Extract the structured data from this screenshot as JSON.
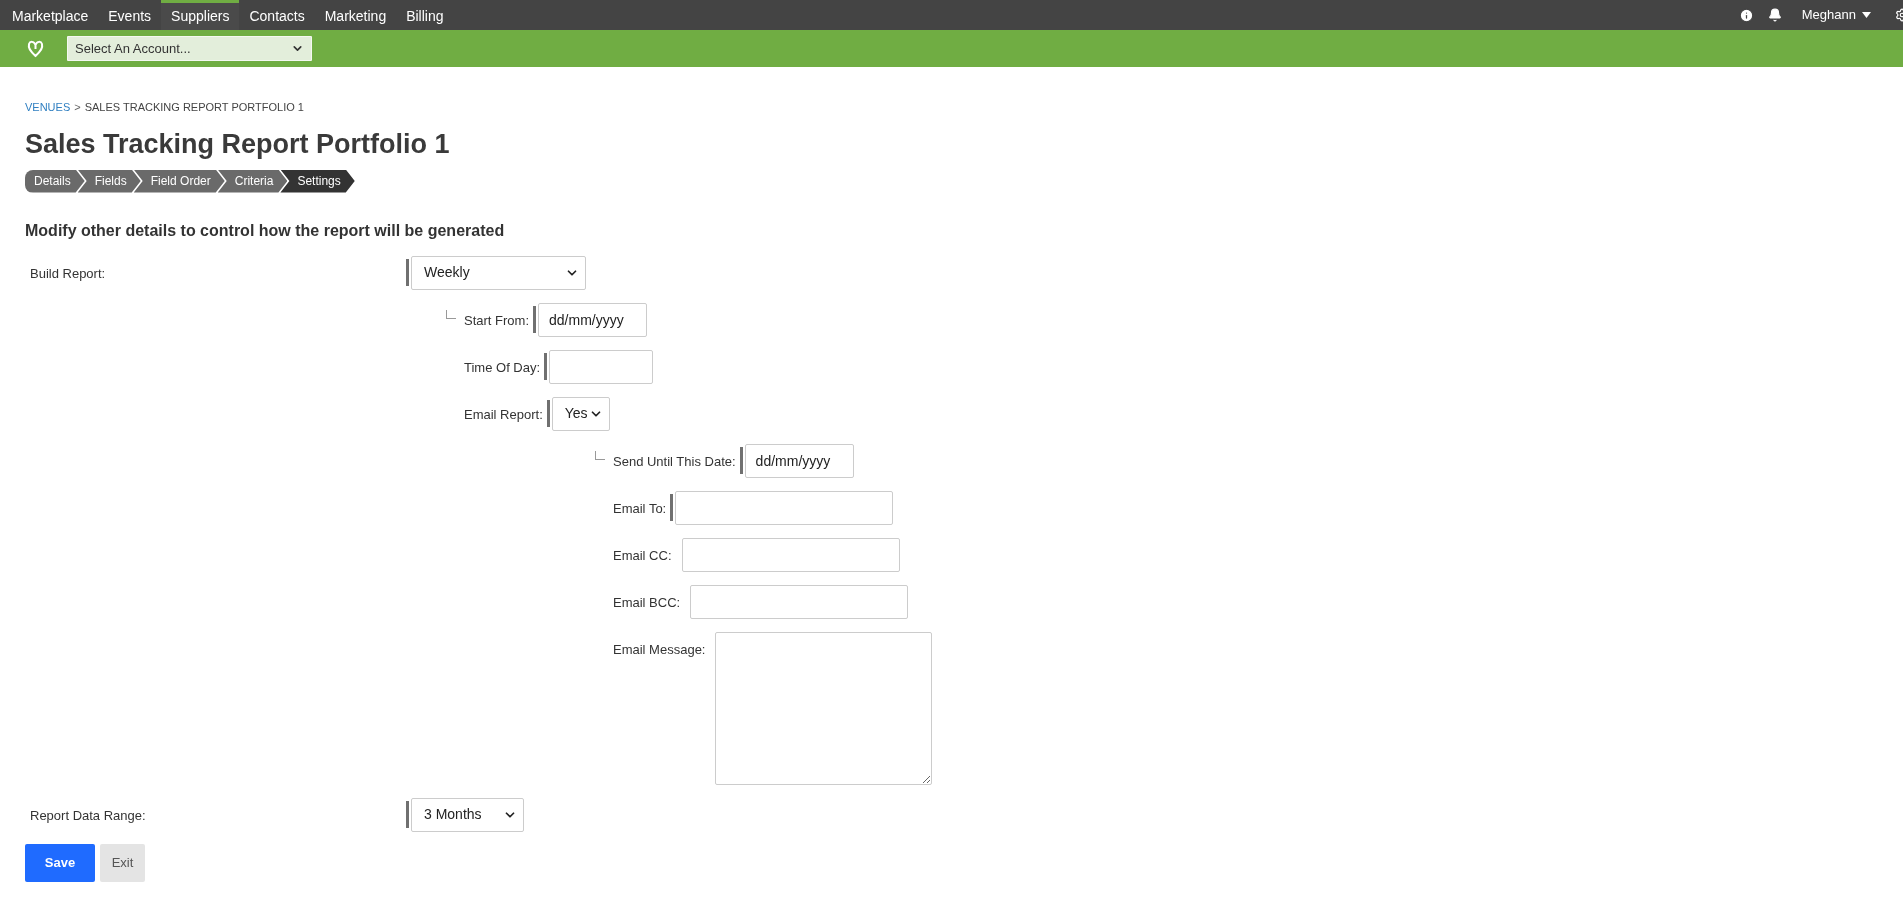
{
  "top_nav": {
    "items": [
      {
        "label": "Marketplace",
        "selected": false
      },
      {
        "label": "Events",
        "selected": false
      },
      {
        "label": "Suppliers",
        "selected": true
      },
      {
        "label": "Contacts",
        "selected": false
      },
      {
        "label": "Marketing",
        "selected": false
      },
      {
        "label": "Billing",
        "selected": false
      }
    ],
    "user": "Meghann"
  },
  "account_bar": {
    "account_select": {
      "value": "Select An Account..."
    }
  },
  "breadcrumb": [
    {
      "label": "VENUES",
      "kind": "link"
    },
    {
      "label": ">",
      "kind": "separator"
    },
    {
      "label": "SALES TRACKING REPORT PORTFOLIO 1",
      "kind": "current"
    }
  ],
  "title": "Sales Tracking Report Portfolio 1",
  "steps": [
    {
      "label": "Details",
      "selected": false
    },
    {
      "label": "Fields",
      "selected": false
    },
    {
      "label": "Field Order",
      "selected": false
    },
    {
      "label": "Criteria",
      "selected": false
    },
    {
      "label": "Settings",
      "selected": true
    }
  ],
  "section_heading": "Modify other details to control how the report will be generated",
  "fields": [
    {
      "label": "Build Report:",
      "kind": "select",
      "value": "Weekly",
      "required": true,
      "children": [
        {
          "label": "Start From:",
          "kind": "date",
          "placeholder": "dd/mm/yyyy",
          "required": true
        },
        {
          "label": "Time Of Day:",
          "kind": "text",
          "required": true
        },
        {
          "label": "Email Report:",
          "kind": "select",
          "value": "Yes",
          "required": true,
          "children": [
            {
              "label": "Send Until This Date:",
              "kind": "date",
              "placeholder": "dd/mm/yyyy",
              "required": true
            },
            {
              "label": "Email To:",
              "kind": "email",
              "required": true
            },
            {
              "label": "Email CC:",
              "kind": "email",
              "required": false
            },
            {
              "label": "Email BCC:",
              "kind": "email",
              "required": false
            },
            {
              "label": "Email Message:",
              "kind": "textarea",
              "required": false
            }
          ]
        }
      ]
    },
    {
      "label": "Report Data Range:",
      "kind": "select",
      "value": "3 Months",
      "required": true
    }
  ],
  "buttons": [
    {
      "label": "Save",
      "kind": "primary"
    },
    {
      "label": "Exit",
      "kind": "secondary"
    }
  ]
}
